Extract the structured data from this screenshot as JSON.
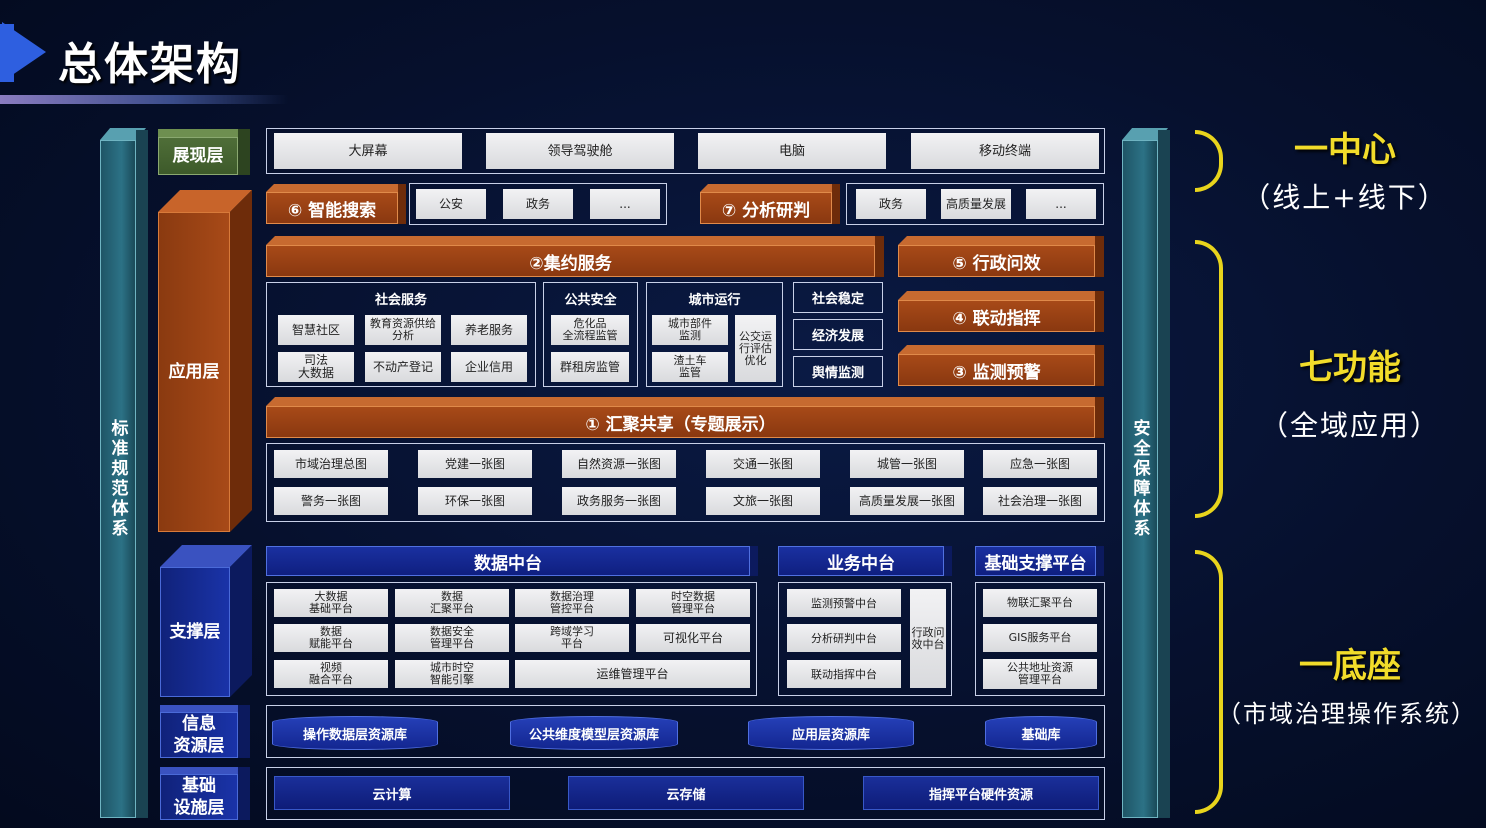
{
  "title": "总体架构",
  "left_pillar": "标准规范体系",
  "right_pillar": "安全保障体系",
  "layers": {
    "display": "展现层",
    "application": "应用层",
    "support": "支撑层",
    "info": "信息\n资源层",
    "infra": "基础\n设施层"
  },
  "display_items": [
    "大屏幕",
    "领导驾驶舱",
    "电脑",
    "移动终端"
  ],
  "smart_search": {
    "label": "⑥ 智能搜索",
    "items": [
      "公安",
      "政务",
      "..."
    ]
  },
  "analysis": {
    "label": "⑦ 分析研判",
    "items": [
      "政务",
      "高质量发展",
      "..."
    ]
  },
  "intensive": "②集约服务",
  "admin": "⑤ 行政问效",
  "command": "④ 联动指挥",
  "monitor": "③ 监测预警",
  "social_service": {
    "header": "社会服务",
    "items": [
      "智慧社区",
      "教育资源供给\n分析",
      "养老服务",
      "司法\n大数据",
      "不动产登记",
      "企业信用"
    ]
  },
  "public_safety": {
    "header": "公共安全",
    "items": [
      "危化品\n全流程监管",
      "群租房监管"
    ]
  },
  "city_ops": {
    "header": "城市运行",
    "items": [
      "城市部件\n监测",
      "渣土车\n监管",
      "公交运\n行评估\n优化"
    ]
  },
  "stability": [
    "社会稳定",
    "经济发展",
    "舆情监测"
  ],
  "gather": "① 汇聚共享（专题展示）",
  "maps": [
    "市域治理总图",
    "党建一张图",
    "自然资源一张图",
    "交通一张图",
    "城管一张图",
    "应急一张图",
    "警务一张图",
    "环保一张图",
    "政务服务一张图",
    "文旅一张图",
    "高质量发展一张图",
    "社会治理一张图"
  ],
  "data_center": {
    "label": "数据中台",
    "items": [
      "大数据\n基础平台",
      "数据\n汇聚平台",
      "数据治理\n管控平台",
      "时空数据\n管理平台",
      "数据\n赋能平台",
      "数据安全\n管理平台",
      "跨域学习\n平台",
      "可视化平台",
      "视频\n融合平台",
      "城市时空\n智能引擎",
      "运维管理平台"
    ]
  },
  "business_center": {
    "label": "业务中台",
    "items": [
      "监测预警中台",
      "分析研判中台",
      "联动指挥中台",
      "行政问\n效中台"
    ]
  },
  "base_platform": {
    "label": "基础支撑平台",
    "items": [
      "物联汇聚平台",
      "GIS服务平台",
      "公共地址资源\n管理平台"
    ]
  },
  "resources": [
    "操作数据层资源库",
    "公共维度模型层资源库",
    "应用层资源库",
    "基础库"
  ],
  "infra_items": [
    "云计算",
    "云存储",
    "指挥平台硬件资源"
  ],
  "side": [
    {
      "big": "一中心",
      "sub": "（线上+线下）"
    },
    {
      "big": "七功能",
      "sub": "（全域应用）"
    },
    {
      "big": "一底座",
      "sub": "（市域治理操作系统）"
    }
  ]
}
